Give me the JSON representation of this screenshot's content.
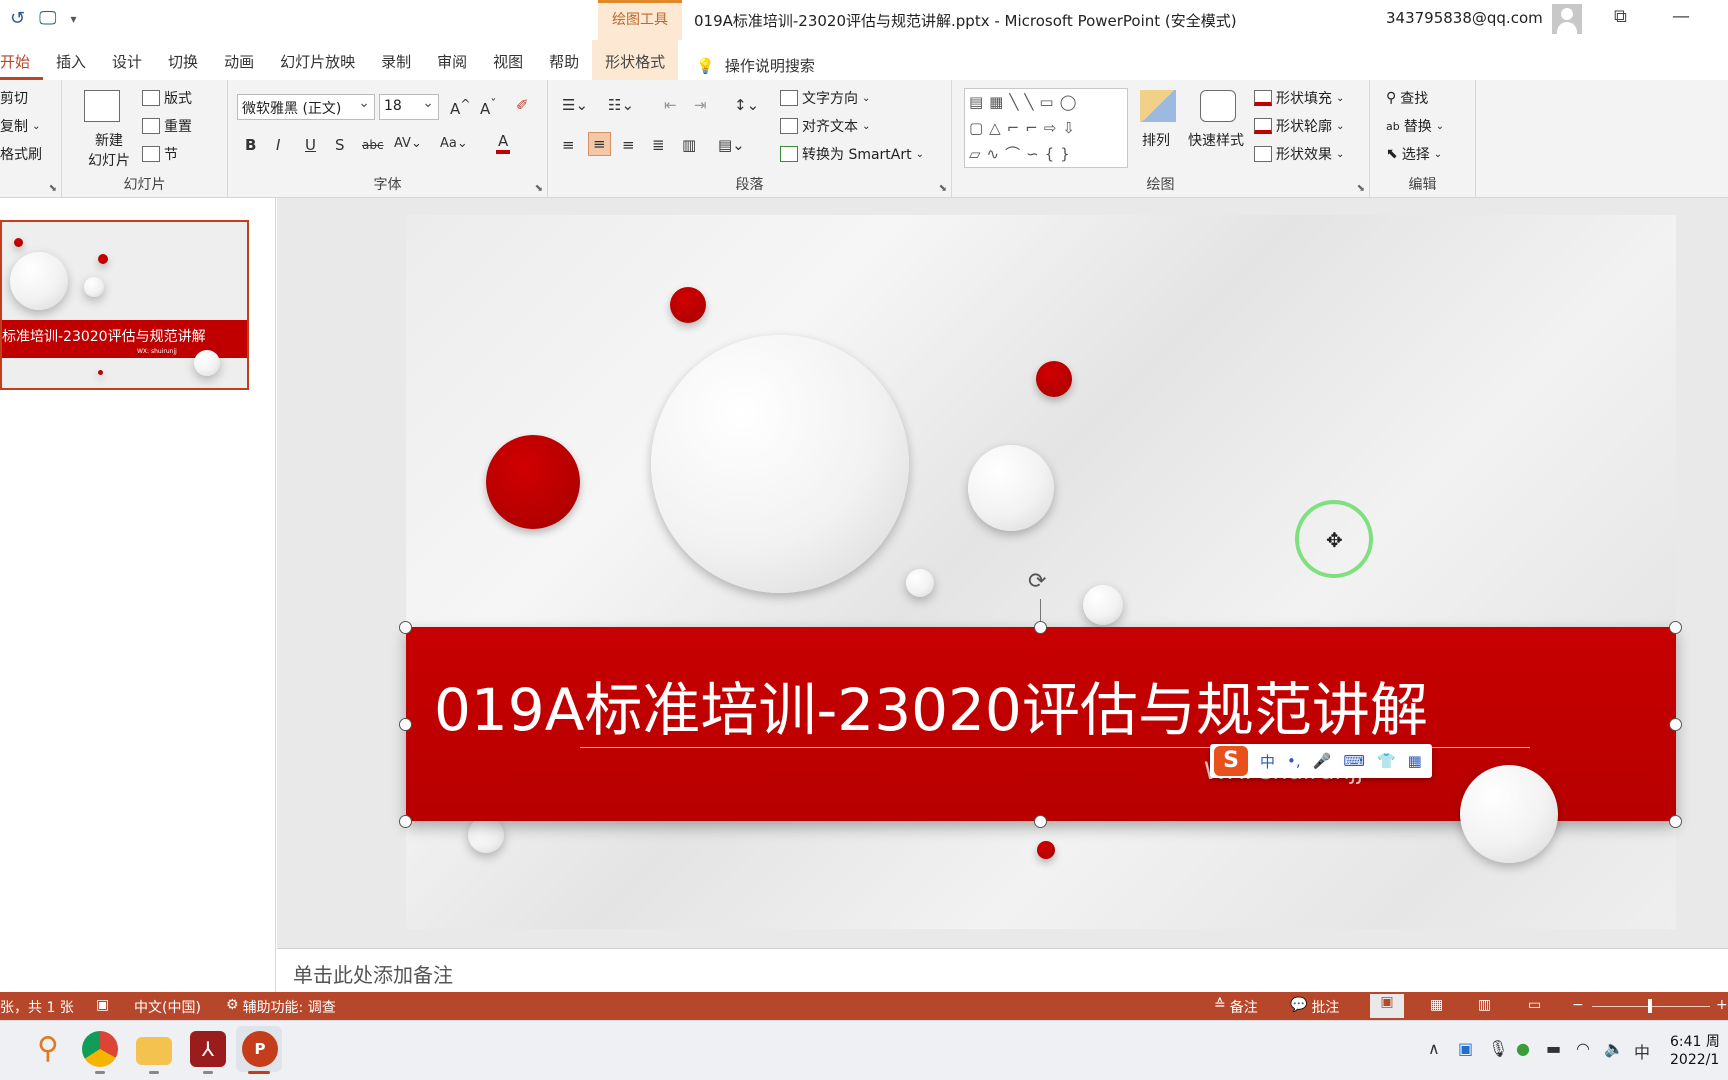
{
  "window": {
    "context_tab_group": "绘图工具",
    "title": "019A标准培训-23020评估与规范讲解.pptx  -  Microsoft PowerPoint (安全模式)",
    "account": "343795838@qq.com"
  },
  "tabs": [
    "开始",
    "插入",
    "设计",
    "切换",
    "动画",
    "幻灯片放映",
    "录制",
    "审阅",
    "视图",
    "帮助",
    "形状格式"
  ],
  "tell_me": "操作说明搜索",
  "ribbon": {
    "clipboard": {
      "cut": "剪切",
      "copy": "复制",
      "painter": "格式刷"
    },
    "slides": {
      "new_slide_1": "新建",
      "new_slide_2": "幻灯片",
      "layout": "版式",
      "reset": "重置",
      "section": "节",
      "label": "幻灯片"
    },
    "font": {
      "name": "微软雅黑 (正文)",
      "size": "18",
      "label": "字体"
    },
    "paragraph": {
      "text_direction": "文字方向",
      "align_text": "对齐文本",
      "smartart": "转换为 SmartArt",
      "label": "段落"
    },
    "drawing": {
      "arrange": "排列",
      "quick_styles": "快速样式",
      "fill": "形状填充",
      "outline": "形状轮廓",
      "effects": "形状效果",
      "label": "绘图"
    },
    "editing": {
      "find": "查找",
      "replace": "替换",
      "select": "选择",
      "label": "编辑"
    }
  },
  "thumbnail": {
    "title": "标准培训-23020评估与规范讲解",
    "sub": "WX: shuirunjj"
  },
  "slide": {
    "title": "019A标准培训-23020评估与规范讲解",
    "subtitle": "WX: shuirunjj"
  },
  "ime": {
    "mode": "中",
    "punct": "•,",
    "mic": "🎤",
    "kbd": "⌨",
    "skin": "👕",
    "grid": "▦"
  },
  "notes_placeholder": "单击此处添加备注",
  "status": {
    "slide_info": "张，共 1 张",
    "language": "中文(中国)",
    "accessibility": "辅助功能: 调查",
    "notes_btn": "备注",
    "comments_btn": "批注"
  },
  "clock": {
    "time": "6:41 周",
    "date": "2022/1"
  },
  "colors": {
    "accent": "#b7472a",
    "title_band": "#c00000",
    "ctx_tab": "#fde9d3"
  }
}
